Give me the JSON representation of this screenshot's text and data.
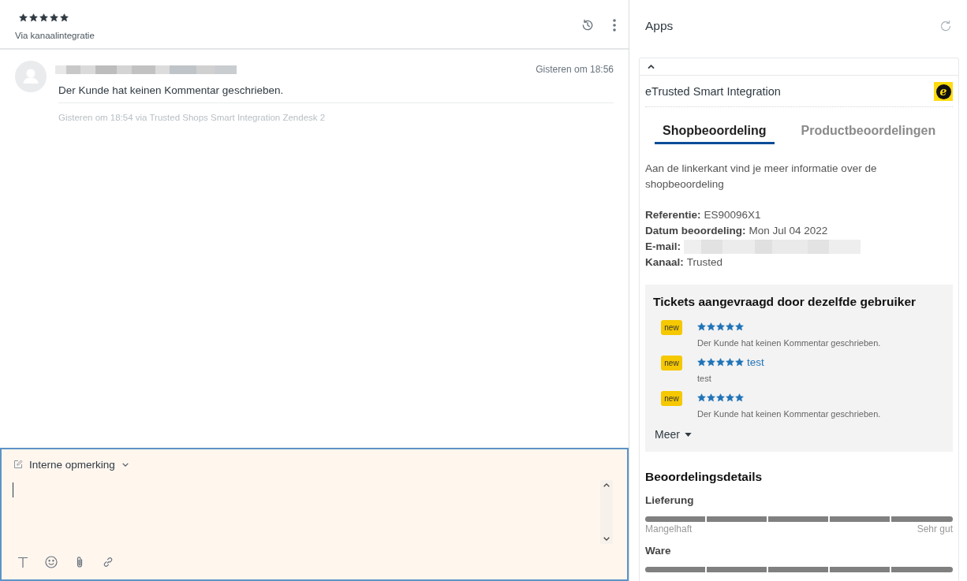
{
  "ticket": {
    "stars": 5,
    "channel": "Via kanaalintegratie"
  },
  "messages": [
    {
      "author_blurred": true,
      "time": "Gisteren om 18:56",
      "body": "Der Kunde hat keinen Kommentar geschrieben.",
      "meta": "Gisteren om 18:54 via Trusted Shops Smart Integration Zendesk 2"
    }
  ],
  "composer": {
    "mode": "Interne opmerking",
    "focused": true
  },
  "apps": {
    "title": "Apps",
    "app": {
      "expanded": true,
      "name": "eTrusted Smart Integration",
      "logo_letter": "e",
      "tabs": [
        {
          "label": "Shopbeoordeling",
          "selected": true
        },
        {
          "label": "Productbeoordelingen",
          "selected": false
        }
      ],
      "intro": "Aan de linkerkant vind je meer informatie over de shopbeoordeling",
      "details": [
        {
          "kind": "text",
          "label": "Referentie:",
          "value": "ES90096X1"
        },
        {
          "kind": "text",
          "label": "Datum beoordeling:",
          "value": "Mon Jul 04 2022"
        },
        {
          "kind": "blurred",
          "label": "E-mail:"
        },
        {
          "kind": "text",
          "label": "Kanaal:",
          "value": "Trusted"
        }
      ],
      "related": {
        "title": "Tickets aangevraagd door dezelfde gebruiker",
        "items": [
          {
            "badge": "new",
            "stars": 5,
            "comment": "Der Kunde hat keinen Kommentar geschrieben."
          },
          {
            "badge": "new",
            "stars": 5,
            "subject": "test",
            "comment": "test"
          },
          {
            "badge": "new",
            "stars": 5,
            "comment": "Der Kunde hat keinen Kommentar geschrieben."
          }
        ],
        "more": "Meer"
      },
      "review_details": {
        "title": "Beoordelingsdetails",
        "criteria": [
          {
            "name": "Lieferung",
            "level": 1,
            "low_label": "Mangelhaft",
            "high_label": "Sehr gut"
          },
          {
            "name": "Ware",
            "level": 1
          }
        ]
      }
    }
  }
}
